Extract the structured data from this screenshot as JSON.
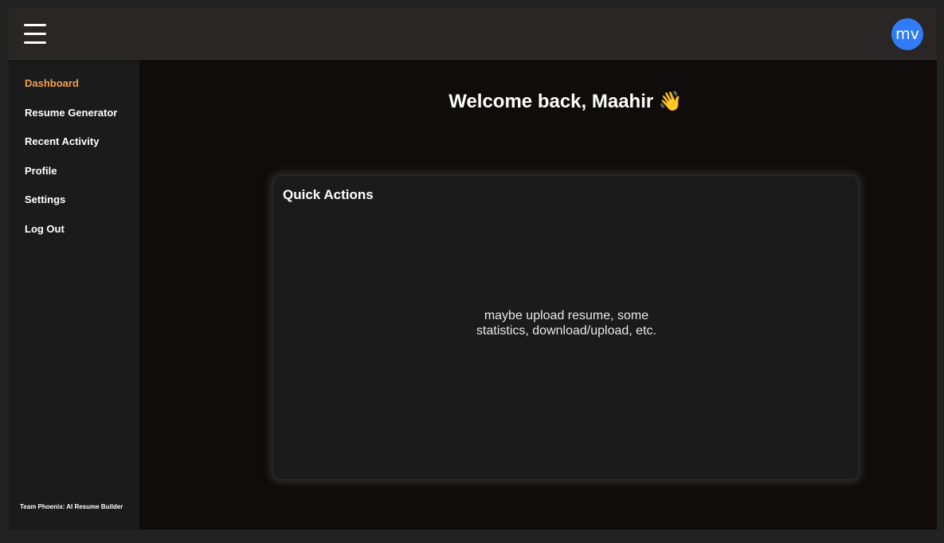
{
  "header": {
    "menu_icon": "hamburger-icon",
    "avatar_initials": "mv",
    "avatar_color": "#2f7cf6"
  },
  "sidebar": {
    "items": [
      {
        "label": "Dashboard",
        "active": true
      },
      {
        "label": "Resume Generator",
        "active": false
      },
      {
        "label": "Recent Activity",
        "active": false
      },
      {
        "label": "Profile",
        "active": false
      },
      {
        "label": "Settings",
        "active": false
      },
      {
        "label": "Log Out",
        "active": false
      }
    ],
    "footer": "Team Phoenix: AI Resume Builder"
  },
  "main": {
    "welcome": "Welcome back, Maahir 👋",
    "card": {
      "title": "Quick Actions",
      "body_line1": "maybe upload resume, some",
      "body_line2": "statistics, download/upload, etc."
    }
  },
  "colors": {
    "accent": "#f0a04b",
    "background": "#0f0c0b",
    "topbar": "#2a2625",
    "sidebar": "#1c1b1b"
  }
}
